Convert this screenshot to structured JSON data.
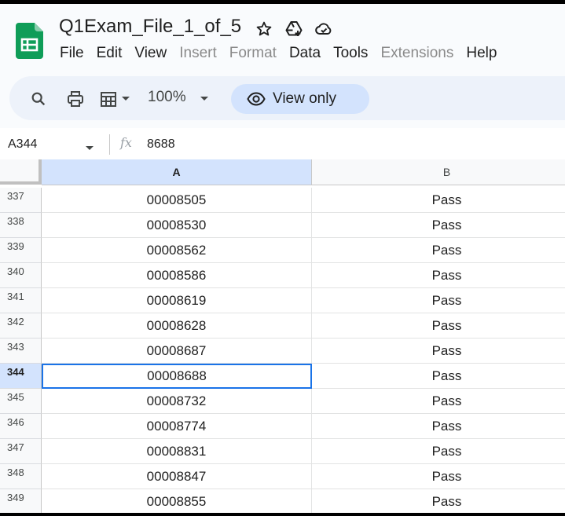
{
  "document": {
    "title": "Q1Exam_File_1_of_5"
  },
  "title_icons": [
    "star-icon",
    "move-to-drive-icon",
    "cloud-status-icon"
  ],
  "menu": [
    {
      "label": "File",
      "disabled": false
    },
    {
      "label": "Edit",
      "disabled": false
    },
    {
      "label": "View",
      "disabled": false
    },
    {
      "label": "Insert",
      "disabled": true
    },
    {
      "label": "Format",
      "disabled": true
    },
    {
      "label": "Data",
      "disabled": false
    },
    {
      "label": "Tools",
      "disabled": false
    },
    {
      "label": "Extensions",
      "disabled": true
    },
    {
      "label": "Help",
      "disabled": false
    }
  ],
  "toolbar": {
    "zoom": "100%",
    "view_only_label": "View only"
  },
  "formula_bar": {
    "name_box": "A344",
    "fx_symbol": "fx",
    "value": "8688"
  },
  "columns": [
    "A",
    "B"
  ],
  "selected": {
    "row": "344",
    "column": "A"
  },
  "rows": [
    {
      "num": "337",
      "a": "00008505",
      "b": "Pass"
    },
    {
      "num": "338",
      "a": "00008530",
      "b": "Pass"
    },
    {
      "num": "339",
      "a": "00008562",
      "b": "Pass"
    },
    {
      "num": "340",
      "a": "00008586",
      "b": "Pass"
    },
    {
      "num": "341",
      "a": "00008619",
      "b": "Pass"
    },
    {
      "num": "342",
      "a": "00008628",
      "b": "Pass"
    },
    {
      "num": "343",
      "a": "00008687",
      "b": "Pass"
    },
    {
      "num": "344",
      "a": "00008688",
      "b": "Pass"
    },
    {
      "num": "345",
      "a": "00008732",
      "b": "Pass"
    },
    {
      "num": "346",
      "a": "00008774",
      "b": "Pass"
    },
    {
      "num": "347",
      "a": "00008831",
      "b": "Pass"
    },
    {
      "num": "348",
      "a": "00008847",
      "b": "Pass"
    },
    {
      "num": "349",
      "a": "00008855",
      "b": "Pass"
    }
  ],
  "colors": {
    "accent": "#0b57d0",
    "sheets_green": "#0f9d58",
    "selection_border": "#1a73e8"
  }
}
